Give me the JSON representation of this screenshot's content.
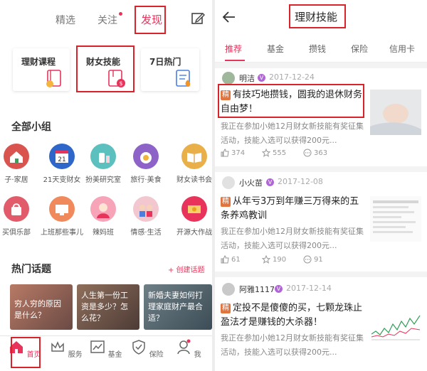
{
  "left": {
    "top_tabs": [
      "精选",
      "关注",
      "发现"
    ],
    "categories": [
      {
        "label": "理财课程",
        "icon": "course-book-icon"
      },
      {
        "label": "财女技能",
        "icon": "skill-book-icon"
      },
      {
        "label": "7日热门",
        "icon": "hot-list-icon"
      }
    ],
    "groups_title": "全部小组",
    "groups": [
      {
        "name": "子·家居"
      },
      {
        "name": "21天变财女"
      },
      {
        "name": "扮美研究室"
      },
      {
        "name": "旅行·美食"
      },
      {
        "name": "财女读书会"
      },
      {
        "name": "买俱乐部"
      },
      {
        "name": "上班那些事儿"
      },
      {
        "name": "辣妈班"
      },
      {
        "name": "情感·生活"
      },
      {
        "name": "开源大作战"
      }
    ],
    "hot_title": "热门话题",
    "create_topic": "+ 创建话题",
    "topics": [
      {
        "text": "穷人穷的原因是什么？"
      },
      {
        "text": "人生第一份工资是多少？怎么花？"
      },
      {
        "text": "新婚夫妻如何打理家庭财产最合适？"
      }
    ],
    "bottom_nav": [
      {
        "label": "首页",
        "icon": "home-icon"
      },
      {
        "label": "服务",
        "icon": "crown-icon"
      },
      {
        "label": "基金",
        "icon": "chart-icon"
      },
      {
        "label": "保险",
        "icon": "umbrella-icon"
      },
      {
        "label": "我",
        "icon": "person-icon"
      }
    ]
  },
  "right": {
    "title": "理财技能",
    "tabs": [
      "推荐",
      "基金",
      "攒钱",
      "保险",
      "信用卡"
    ],
    "posts": [
      {
        "user": "明洁",
        "date": "2017-12-24",
        "badge": "精",
        "title": "有技巧地攒钱，圆我的退休财务自由梦！",
        "desc": "我正在参加小她12月财女新技能有奖征集活动，技能入选可以获得200元...",
        "likes": "374",
        "stars": "555",
        "comments": "363"
      },
      {
        "user": "小火苗",
        "date": "2017-12-08",
        "badge": "精",
        "title": "从年亏3万到年赚三万得来的五条养鸡教训",
        "desc": "我正在参加小她12月财女新技能有奖征集活动，技能入选可以获得200元...",
        "likes": "61",
        "stars": "190",
        "comments": "91"
      },
      {
        "user": "阿雅1117",
        "date": "2017-12-14",
        "badge": "精",
        "title": "定投不是傻傻的买，七颗龙珠止盈法才是赚钱的大杀器！",
        "desc": "我正在参加小她12月财女新技能有奖征集活动，技能入选可以获得200元...",
        "likes": "",
        "stars": "",
        "comments": ""
      }
    ]
  },
  "colors": {
    "accent": "#e8345a",
    "highlight_box": "#d8232a",
    "verified": "#b066d6",
    "jing": "#e2753d"
  }
}
